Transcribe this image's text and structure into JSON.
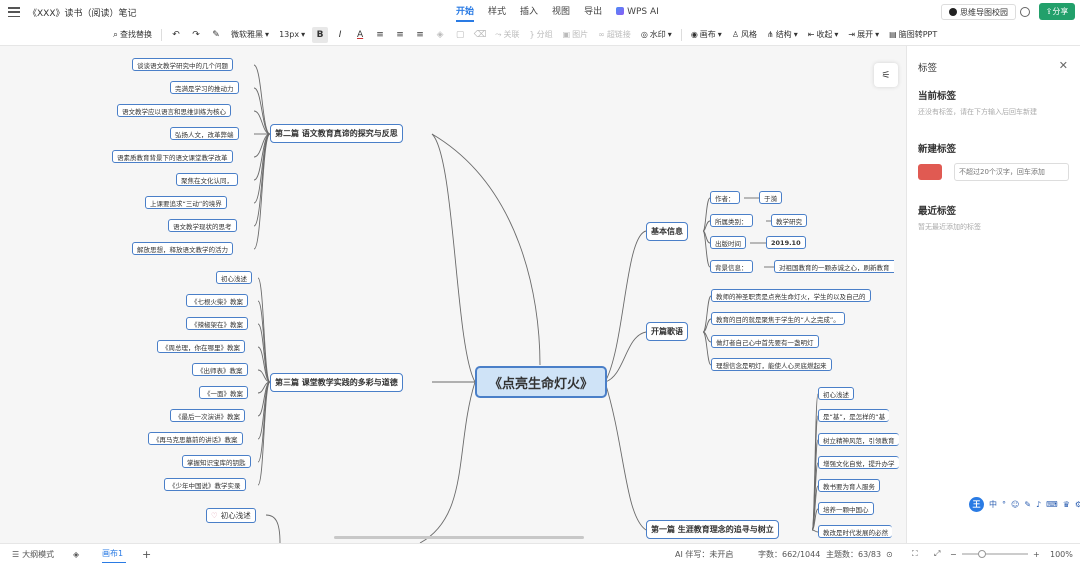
{
  "titlebar": {
    "doc_title": "《XXX》读书（阅读）笔记",
    "tabs": [
      "开始",
      "样式",
      "插入",
      "视图",
      "导出",
      "WPS AI"
    ],
    "active_tab": "开始",
    "brand": "思维导图校园",
    "share": "分享"
  },
  "toolbar": {
    "find_replace": "查找替换",
    "font": "微软雅黑",
    "font_size": "13px",
    "associate": "关联",
    "summary": "分组",
    "image": "图片",
    "hyperlink": "超链接",
    "watermark": "水印",
    "canvas": "画布",
    "style": "风格",
    "structure": "结构",
    "collapse": "收起",
    "expand": "展开",
    "to_ppt": "脑图转PPT"
  },
  "mindmap": {
    "root": "《点亮生命灯火》",
    "sections": {
      "s2": "第二篇 语文教育真谛的探究与反思",
      "s3": "第三篇 课堂教学实践的多彩与道德",
      "basic": "基本信息",
      "opening": "开篇歌语",
      "s1": "第一篇 生涯教育理念的追寻与树立"
    },
    "s2_items": [
      "谈谈语文教学研究中的几个问题",
      "完满是学习的推动力",
      "语文教学应以语言和思维训练为核心",
      "弘扬人文，改革弊端",
      "语素质教育背景下的语文课堂教学改革",
      "聚焦在文化认同，",
      "上课要追求“三动”的境界",
      "语文教学现状的思考",
      "解放思想，释放语文教学的活力"
    ],
    "s3_items": [
      "初心浅述",
      "《七根火柴》教案",
      "《辣椒架在》教案",
      "《周总理，你在哪里》教案",
      "《出师表》教案",
      "《一面》教案",
      "《最后一次演讲》教案",
      "《再马克思墓前的讲话》教案",
      "掌握知识宝库的钥匙",
      "《少年中国说》教学实录"
    ],
    "bottom_left": "初心浅述",
    "basic_labels": [
      "作者：",
      "所属类别：",
      "出版时间",
      "背景信息："
    ],
    "basic_values": [
      "于漪",
      "教学研究",
      "2019.10",
      "对祖国教育的一颗赤诚之心，刷新教育"
    ],
    "opening_items": [
      "教师的神圣职责是点亮生命灯火，学生的以及自己的",
      "教育的目的就是聚焦于学生的“人之完成”。",
      "做灯者自己心中首先要有一盏明灯",
      "理想信念是明灯，能使人心灵底燃起来"
    ],
    "s1_items": [
      "初心浅述",
      "是“基”，是怎样的“基",
      "树立精神风范，引领教育",
      "增强文化自觉，提升办学",
      "教书要为育人服务",
      "培养一颗中国心",
      "教改是时代发展的必然"
    ]
  },
  "panel": {
    "title": "标签",
    "current": "当前标签",
    "current_hint": "还没有标签，请在下方输入后回车新建",
    "new": "新建标签",
    "new_placeholder": "不超过20个汉字，回车添加",
    "new_color": "#e05a52",
    "recent": "最近标签",
    "recent_hint": "暂无最近添加的标签"
  },
  "statusbar": {
    "outline": "大纲模式",
    "canvas_tab": "画布1",
    "ai": "AI 伴写：未开启",
    "words": "字数：662/1044",
    "topics": "主题数：63/83",
    "zoom": "100%",
    "zoom_level": 0.3
  },
  "colors": {
    "accent": "#2a7be4",
    "node_border": "#4a7fc8",
    "root_fill": "#cfe3f7",
    "share": "#22a06b"
  }
}
